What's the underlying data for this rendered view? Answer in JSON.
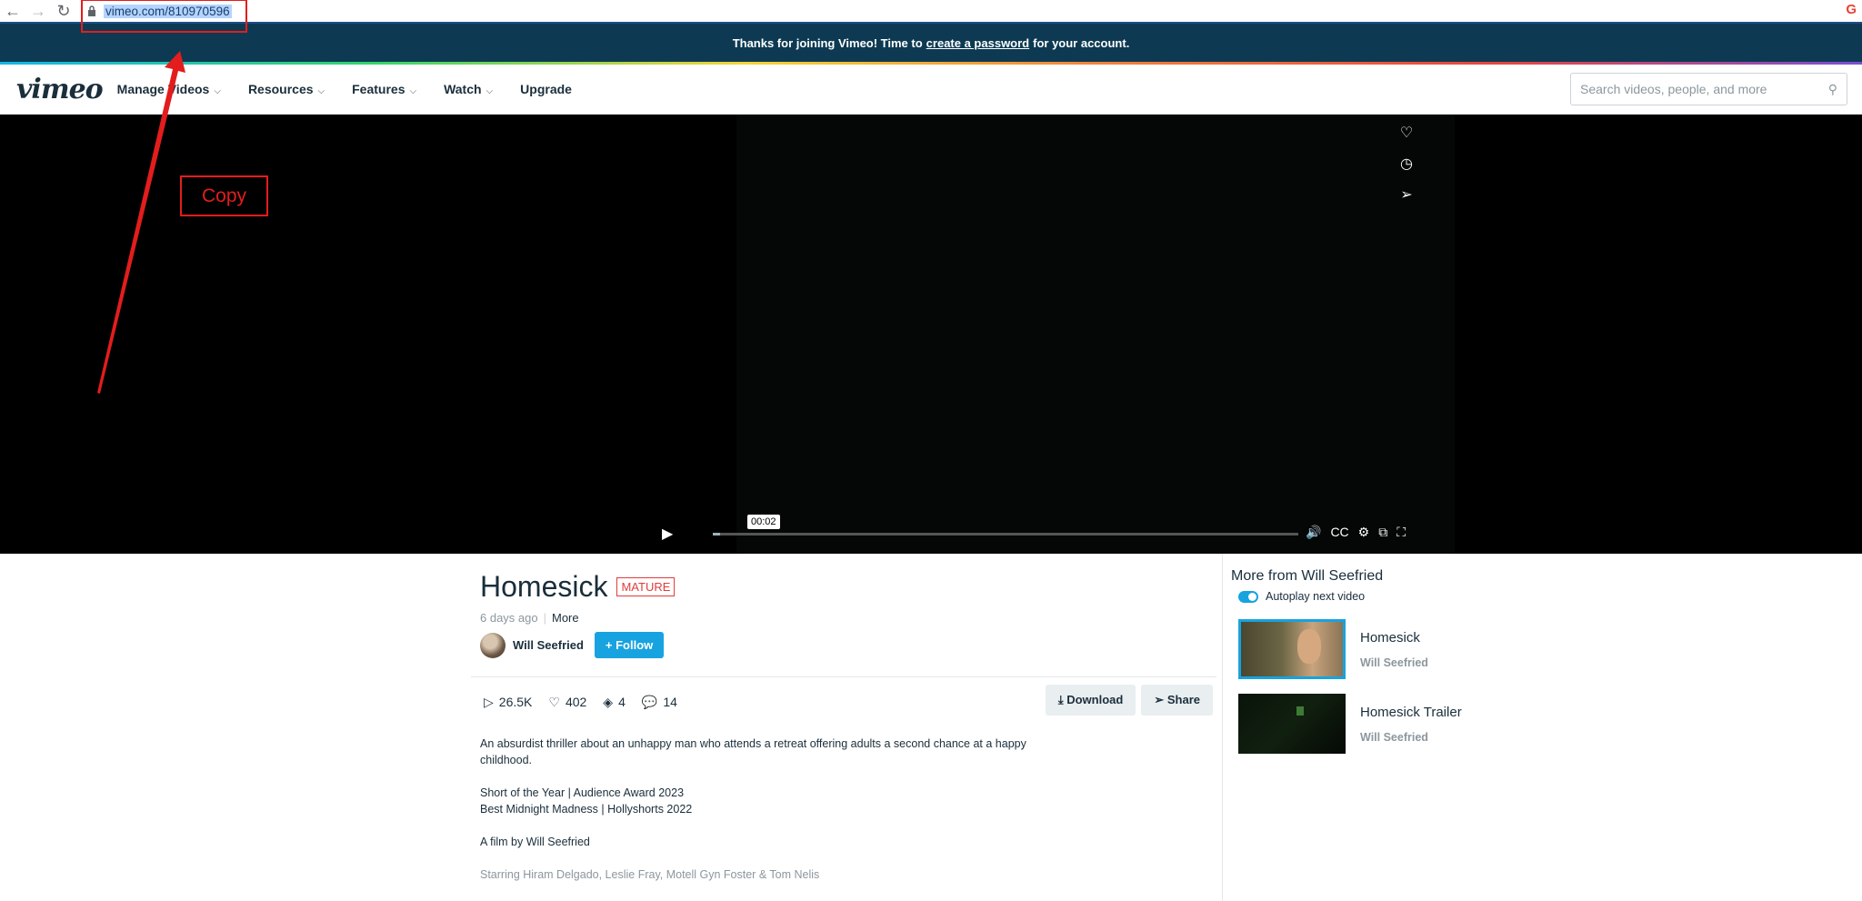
{
  "browser": {
    "back_glyph": "←",
    "forward_glyph": "→",
    "reload_glyph": "↻",
    "url": "vimeo.com/810970596",
    "google_glyph": "G"
  },
  "banner": {
    "text_before": "Thanks for joining Vimeo! Time to",
    "link": "create a password",
    "text_after": "for your account."
  },
  "nav": {
    "logo": "vimeo",
    "items": [
      {
        "label": "Manage Videos",
        "has_chevron": true
      },
      {
        "label": "Resources",
        "has_chevron": true
      },
      {
        "label": "Features",
        "has_chevron": true
      },
      {
        "label": "Watch",
        "has_chevron": true
      },
      {
        "label": "Upgrade",
        "has_chevron": false
      }
    ],
    "chevron_glyph": "⌵",
    "search_placeholder": "Search videos, people, and more",
    "search_glyph": "⚲"
  },
  "player": {
    "side_icons": [
      "♡",
      "◷",
      "➢"
    ],
    "play_glyph": "▶",
    "current_time": "00:02",
    "progress_fraction": 0.012,
    "control_icons": [
      "🔊",
      "CC",
      "⚙",
      "⧉",
      "⛶"
    ]
  },
  "annotation": {
    "copy_label": "Copy",
    "color": "#e31d1d"
  },
  "video": {
    "title": "Homesick",
    "badge": "MATURE",
    "posted": "6 days ago",
    "more_label": "More",
    "owner": "Will Seefried",
    "follow_label": "+ Follow",
    "stats": {
      "plays": "26.5K",
      "likes": "402",
      "collections": "4",
      "comments": "14"
    },
    "stat_glyphs": {
      "plays": "▷",
      "likes": "♡",
      "collections": "◈",
      "comments": "💬"
    },
    "download_label": "Download",
    "download_glyph": "⤓",
    "share_label": "Share",
    "share_glyph": "➢",
    "description": [
      "An absurdist thriller about an unhappy man who attends a retreat offering adults a second chance at a happy childhood.",
      "Short of the Year | Audience Award 2023\nBest Midnight Madness | Hollyshorts 2022",
      "A film by Will Seefried"
    ],
    "starring": "Starring Hiram Delgado, Leslie Fray, Motell Gyn Foster & Tom Nelis"
  },
  "sidebar": {
    "title": "More from Will Seefried",
    "autoplay_label": "Autoplay next video",
    "autoplay_on": true,
    "videos": [
      {
        "title": "Homesick",
        "owner": "Will Seefried"
      },
      {
        "title": "Homesick Trailer",
        "owner": "Will Seefried"
      }
    ]
  },
  "colors": {
    "accent": "#17a3e0",
    "banner_bg": "#0d3a52",
    "mature": "#e23c3c"
  }
}
